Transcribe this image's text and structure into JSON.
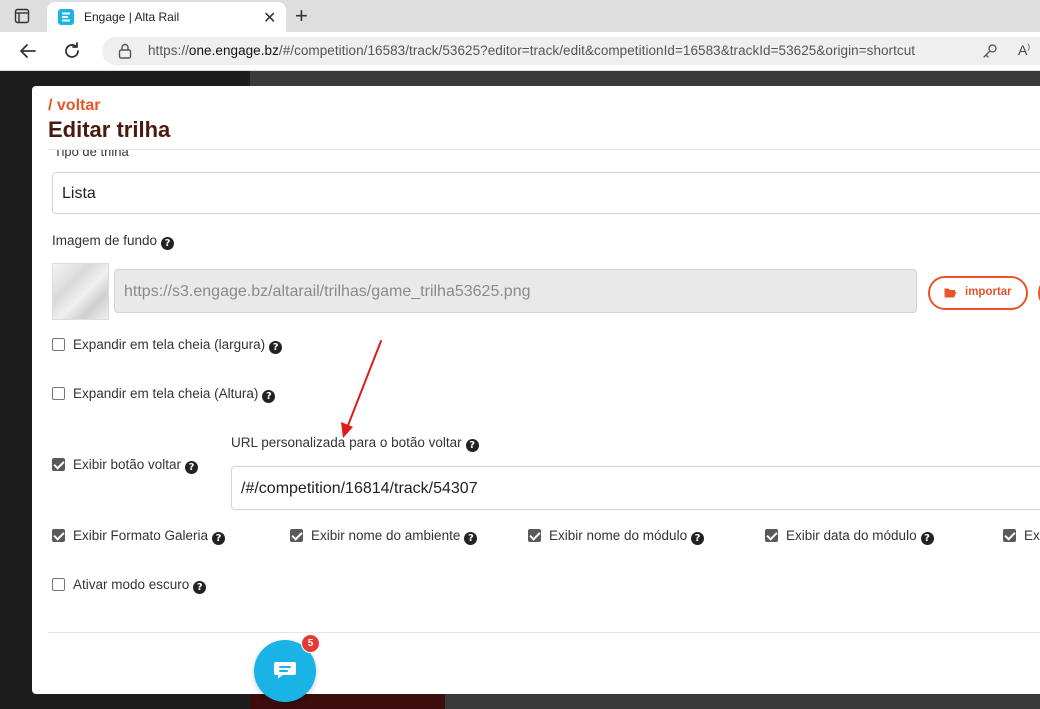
{
  "browser": {
    "tab_title": "Engage | Alta Rail",
    "url_prefix": "https://",
    "url_host": "one.engage.bz",
    "url_rest": "/#/competition/16583/track/53625?editor=track/edit&competitionId=16583&trackId=53625&origin=shortcut"
  },
  "modal": {
    "back_label": "/ voltar",
    "title": "Editar trilha"
  },
  "form": {
    "track_type_label": "Tipo de trilha",
    "track_type_value": "Lista",
    "bg_image_label": "Imagem de fundo",
    "bg_image_url": "https://s3.engage.bz/altarail/trilhas/game_trilha53625.png",
    "import_label": "importar",
    "expand_width_label": "Expandir em tela cheia (largura)",
    "expand_height_label": "Expandir em tela cheia (Altura)",
    "show_back_label": "Exibir botão voltar",
    "custom_url_label": "URL personalizada para o botão voltar",
    "custom_url_value": "/#/competition/16814/track/54307",
    "gallery_label": "Exibir Formato Galeria",
    "env_name_label": "Exibir nome do ambiente",
    "module_name_label": "Exibir nome do módulo",
    "module_date_label": "Exibir data do módulo",
    "cut_option_label": "Ex",
    "dark_mode_label": "Ativar modo escuro"
  },
  "chat": {
    "badge_count": "5"
  },
  "colors": {
    "accent": "#e8542a",
    "title": "#4a1a10",
    "chat": "#1ab3e6"
  }
}
